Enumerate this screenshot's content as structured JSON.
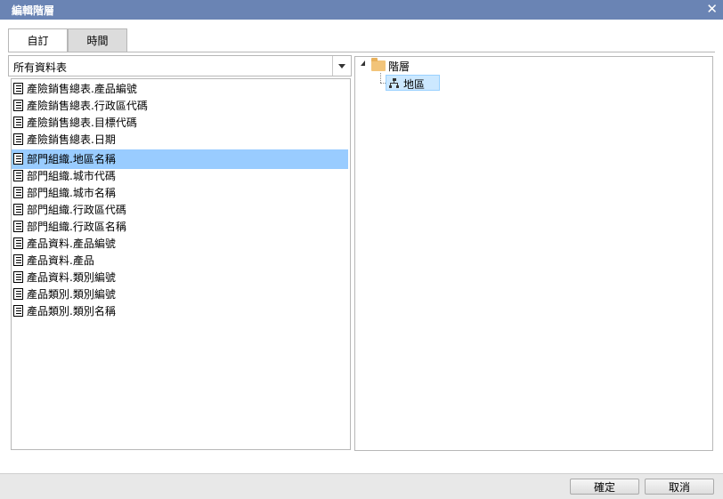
{
  "window": {
    "title": "編輯階層",
    "close_glyph": "✕"
  },
  "tabs": [
    {
      "label": "自訂",
      "active": true
    },
    {
      "label": "時間",
      "active": false
    }
  ],
  "source_select": {
    "value": "所有資料表"
  },
  "fields": [
    {
      "label": "產險銷售總表.產品編號",
      "selected": false
    },
    {
      "label": "產險銷售總表.行政區代碼",
      "selected": false
    },
    {
      "label": "產險銷售總表.目標代碼",
      "selected": false
    },
    {
      "label": "產險銷售總表.日期",
      "selected": false
    },
    {
      "label": "部門組織.地區名稱",
      "selected": true
    },
    {
      "label": "部門組織.城市代碼",
      "selected": false
    },
    {
      "label": "部門組織.城市名稱",
      "selected": false
    },
    {
      "label": "部門組織.行政區代碼",
      "selected": false
    },
    {
      "label": "部門組織.行政區名稱",
      "selected": false
    },
    {
      "label": "產品資料.產品編號",
      "selected": false
    },
    {
      "label": "產品資料.產品",
      "selected": false
    },
    {
      "label": "產品資料.類別編號",
      "selected": false
    },
    {
      "label": "產品類別.類別編號",
      "selected": false
    },
    {
      "label": "產品類別.類別名稱",
      "selected": false
    }
  ],
  "hierarchy_tree": {
    "root": {
      "label": "階層",
      "icon": "folder-icon"
    },
    "children": [
      {
        "label": "地區",
        "icon": "hierarchy-icon",
        "selected": true
      }
    ]
  },
  "footer": {
    "ok_label": "確定",
    "cancel_label": "取消"
  },
  "colors": {
    "titlebar": "#6a84b4",
    "selection": "#99ccff",
    "tree_selection": "#cce8ff"
  }
}
